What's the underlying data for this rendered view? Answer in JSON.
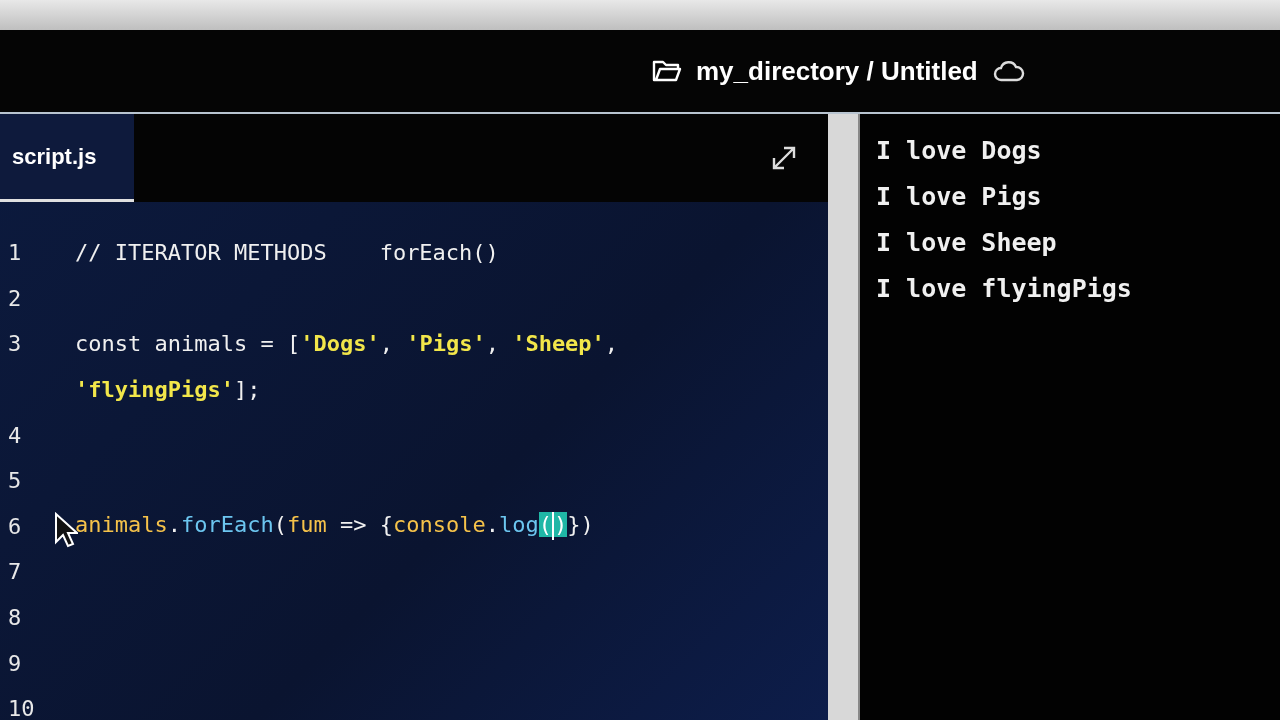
{
  "header": {
    "path": "my_directory / Untitled"
  },
  "editor": {
    "tab": {
      "label": "script.js",
      "selected": true
    },
    "lines": [
      {
        "number": "1",
        "tokens": [
          {
            "kind": "plain",
            "text": "// ITERATOR METHODS    forEach()"
          }
        ]
      },
      {
        "number": "2"
      },
      {
        "number": "3",
        "tokens": [
          {
            "kind": "plain",
            "text": "const animals = ["
          },
          {
            "kind": "string",
            "text": "'Dogs'"
          },
          {
            "kind": "plain",
            "text": ", "
          },
          {
            "kind": "string",
            "text": "'Pigs'"
          },
          {
            "kind": "plain",
            "text": ", "
          },
          {
            "kind": "string",
            "text": "'Sheep'"
          },
          {
            "kind": "plain",
            "text": ","
          }
        ],
        "continuation": [
          {
            "kind": "string",
            "text": "'flyingPigs'"
          },
          {
            "kind": "plain",
            "text": "];"
          }
        ]
      },
      {
        "number": "4"
      },
      {
        "number": "5"
      },
      {
        "number": "6",
        "tokens": [
          {
            "kind": "variable",
            "text": "animals"
          },
          {
            "kind": "plain",
            "text": "."
          },
          {
            "kind": "method",
            "text": "forEach"
          },
          {
            "kind": "plain",
            "text": "("
          },
          {
            "kind": "variable",
            "text": "fum"
          },
          {
            "kind": "plain",
            "text": " => {"
          },
          {
            "kind": "variable",
            "text": "console"
          },
          {
            "kind": "plain",
            "text": "."
          },
          {
            "kind": "method",
            "text": "log"
          },
          {
            "kind": "match",
            "text": "("
          },
          {
            "kind": "caret"
          },
          {
            "kind": "match",
            "text": ")"
          },
          {
            "kind": "plain",
            "text": "})"
          }
        ]
      },
      {
        "number": "7"
      },
      {
        "number": "8"
      },
      {
        "number": "9"
      },
      {
        "number": "10"
      }
    ]
  },
  "console": {
    "lines": [
      "I love Dogs",
      "I love Pigs",
      "I love Sheep",
      "I love flyingPigs"
    ]
  }
}
